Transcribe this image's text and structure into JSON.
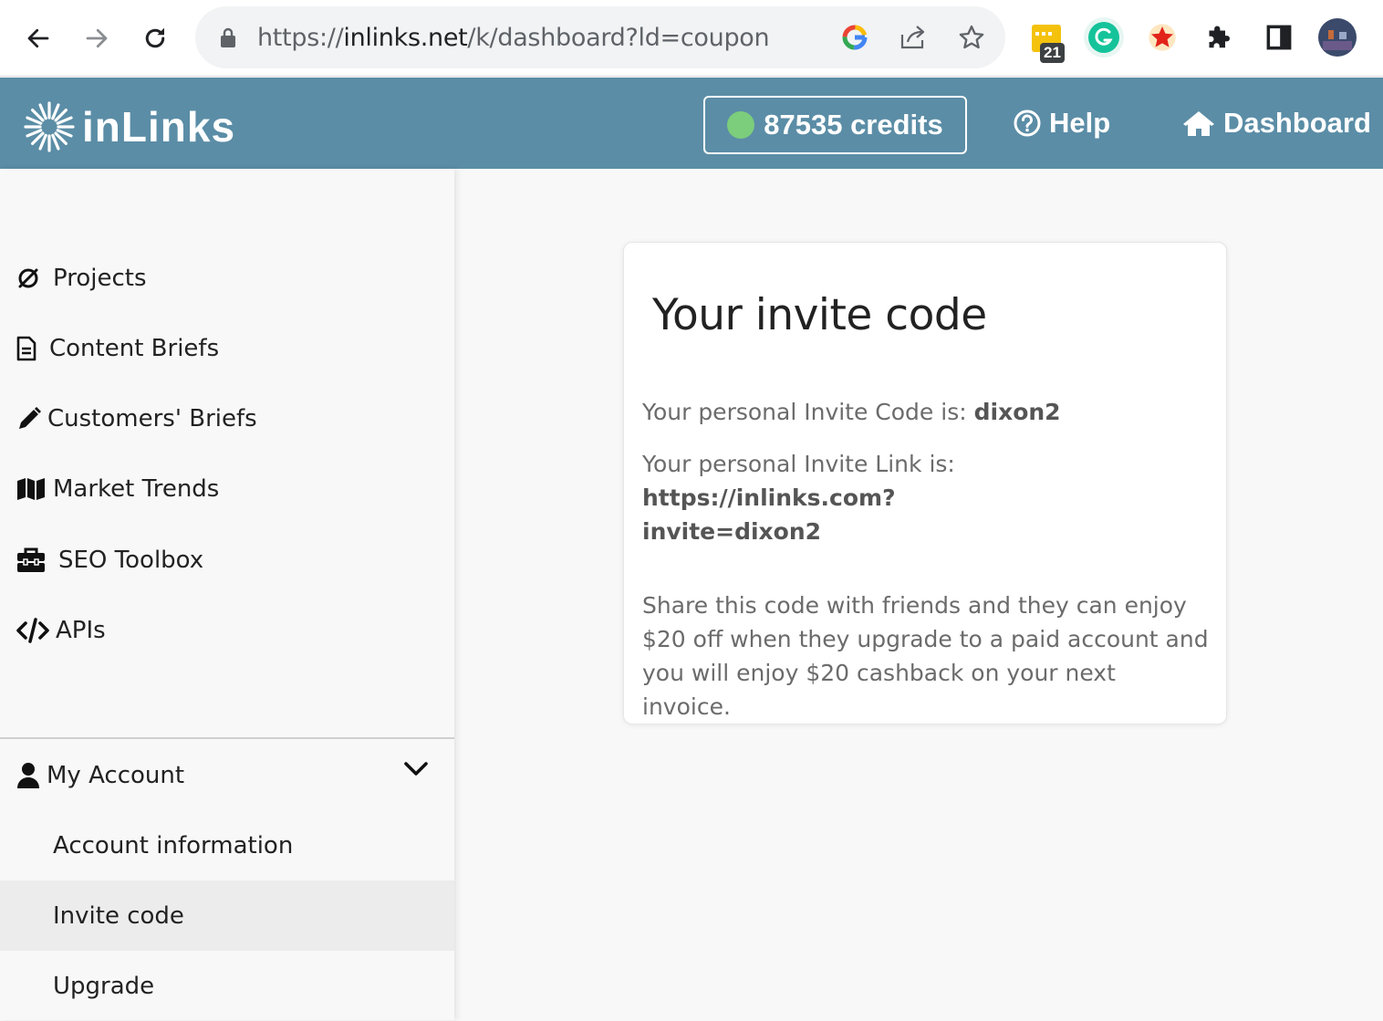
{
  "browser": {
    "url_prefix": "https://",
    "url_host": "inlinks.net",
    "url_path": "/k/dashboard?ld=coupon",
    "extension_badge": "21"
  },
  "header": {
    "logo_text": "inLinks",
    "credits_label": "87535 credits",
    "help_label": "Help",
    "dashboard_label": "Dashboard"
  },
  "sidebar": {
    "items": [
      {
        "label": "Projects",
        "icon": "circle-arrow-icon"
      },
      {
        "label": "Content Briefs",
        "icon": "document-icon"
      },
      {
        "label": "Customers' Briefs",
        "icon": "pencil-icon"
      },
      {
        "label": "Market Trends",
        "icon": "map-icon"
      },
      {
        "label": "SEO Toolbox",
        "icon": "toolbox-icon"
      },
      {
        "label": "APIs",
        "icon": "code-icon"
      }
    ],
    "account": {
      "label": "My Account",
      "sub_items": [
        {
          "label": "Account information"
        },
        {
          "label": "Invite code"
        },
        {
          "label": "Upgrade"
        }
      ],
      "active": "Invite code"
    }
  },
  "card": {
    "title": "Your invite code",
    "code_prefix": "Your personal Invite Code is:",
    "code_value": "dixon2",
    "link_prefix": "Your personal Invite Link is:",
    "link_value_line1": "https://inlinks.com?",
    "link_value_line2": "invite=dixon2",
    "share_text_line1": "Share this code with friends and they can enjoy",
    "share_text_line2": "$20 off when they upgrade to a paid account and",
    "share_text_line3": "you will enjoy $20 cashback on your next invoice."
  },
  "colors": {
    "header_bg": "#5b8da6",
    "credits_dot": "#7ccd7c",
    "sidebar_active": "#ececec"
  }
}
